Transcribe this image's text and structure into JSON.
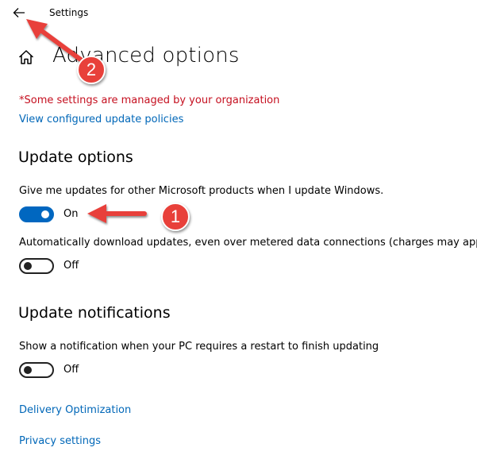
{
  "window": {
    "title": "Settings",
    "back_icon": "back-arrow-icon"
  },
  "header": {
    "home_icon": "home-icon",
    "title": "Advanced options"
  },
  "notice": {
    "managed_text": "*Some settings are managed by your organization",
    "policies_link": "View configured update policies"
  },
  "update_options": {
    "title": "Update options",
    "settings": [
      {
        "label": "Give me updates for other Microsoft products when I update Windows.",
        "state": "On",
        "on": true
      },
      {
        "label": "Automatically download updates, even over metered data connections (charges may apply)",
        "state": "Off",
        "on": false
      }
    ]
  },
  "update_notifications": {
    "title": "Update notifications",
    "settings": [
      {
        "label": "Show a notification when your PC requires a restart to finish updating",
        "state": "Off",
        "on": false
      }
    ]
  },
  "links": {
    "delivery_optimization": "Delivery Optimization",
    "privacy_settings": "Privacy settings"
  },
  "annotations": [
    {
      "number": "1"
    },
    {
      "number": "2"
    }
  ],
  "colors": {
    "accent": "#0067c0",
    "link": "#0067b8",
    "warning": "#c50f1f",
    "annotation": "#e8403a"
  }
}
